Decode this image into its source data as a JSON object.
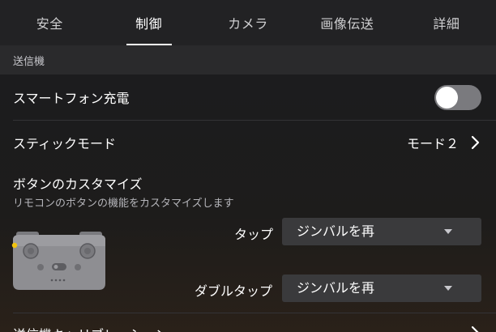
{
  "tabs": [
    {
      "label": "安全",
      "active": false
    },
    {
      "label": "制御",
      "active": true
    },
    {
      "label": "カメラ",
      "active": false
    },
    {
      "label": "画像伝送",
      "active": false
    },
    {
      "label": "詳細",
      "active": false
    }
  ],
  "section": {
    "title": "送信機"
  },
  "rows": {
    "charging": {
      "label": "スマートフォン充電",
      "toggle_on": false
    },
    "stick_mode": {
      "label": "スティックモード",
      "value": "モード２"
    },
    "customize": {
      "title": "ボタンのカスタマイズ",
      "description": "リモコンのボタンの機能をカスタマイズします",
      "tap": {
        "label": "タップ",
        "value": "ジンバルを再"
      },
      "double_tap": {
        "label": "ダブルタップ",
        "value": "ジンバルを再"
      }
    },
    "next_partial": {
      "label": "送信機キャリブレーション"
    }
  },
  "colors": {
    "accent_dot": "#f2c40f",
    "toggle_off": "#7a7a7e",
    "controller_body": "#8e8e92"
  },
  "icons": {
    "chevron": "chevron-right-icon",
    "caret": "caret-down-icon",
    "controller": "remote-controller-icon"
  }
}
